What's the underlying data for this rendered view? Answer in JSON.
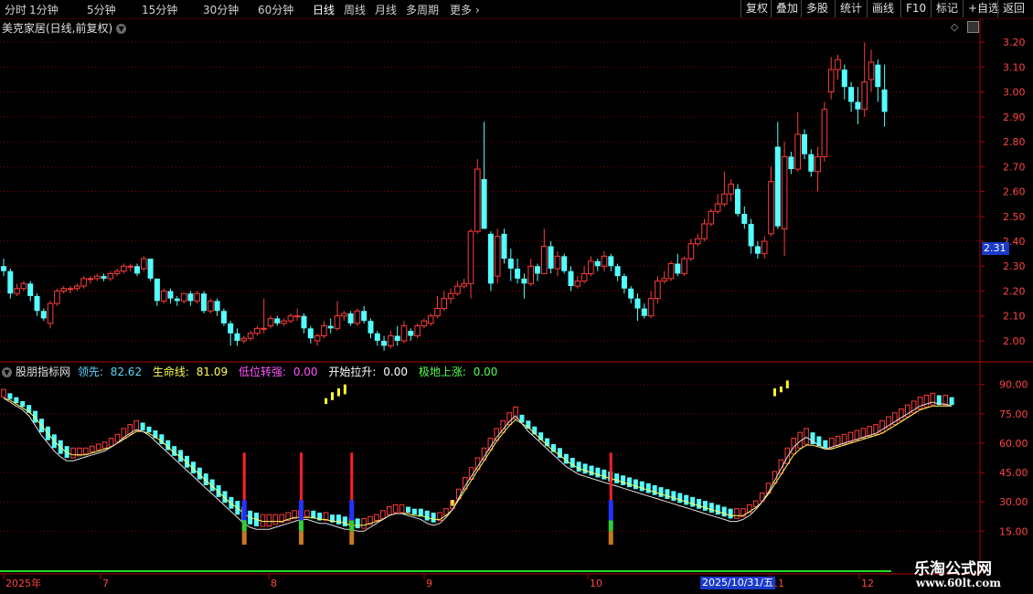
{
  "toolbar": {
    "periods": [
      "分时",
      "1分钟",
      "5分钟",
      "15分钟",
      "30分钟",
      "60分钟",
      "日线",
      "周线",
      "月线",
      "多周期",
      "更多"
    ],
    "active_period": "日线",
    "buttons": [
      "复权",
      "叠加",
      "多股",
      "统计",
      "画线",
      "F10",
      "标记",
      "+自选",
      "返回"
    ]
  },
  "stock": {
    "title": "美克家居(日线,前复权)"
  },
  "price_axis": {
    "ticks": [
      "3.20",
      "3.10",
      "3.00",
      "2.90",
      "2.80",
      "2.70",
      "2.60",
      "2.50",
      "2.40",
      "2.30",
      "2.20",
      "2.10",
      "2.00"
    ],
    "current_price": "2.31"
  },
  "indicator": {
    "name": "股朋指标网",
    "items": [
      {
        "label": "领先:",
        "value": "82.62",
        "color": "#5bd8ff"
      },
      {
        "label": "生命线:",
        "value": "81.09",
        "color": "#ffff55"
      },
      {
        "label": "低位转强:",
        "value": "0.00",
        "color": "#ff55ff"
      },
      {
        "label": "开始拉升:",
        "value": "0.00",
        "color": "#ffffff"
      },
      {
        "label": "极地上涨:",
        "value": "0.00",
        "color": "#55ff55"
      }
    ],
    "ticks": [
      "90.00",
      "75.00",
      "60.00",
      "45.00",
      "30.00",
      "15.00"
    ]
  },
  "time_axis": {
    "labels": [
      "2025年",
      "7",
      "8",
      "9",
      "10",
      "11",
      "12"
    ],
    "cursor_date": "2025/10/31/五"
  },
  "watermark": {
    "line1": "乐淘公式网",
    "line2": "www.60lt.com"
  },
  "colors": {
    "up": "#ff3c3c",
    "down": "#54ffff",
    "grid": "#8b0000",
    "axis": "#b00000"
  },
  "chart_data": {
    "type": "candlestick",
    "note_series": [
      "open",
      "close",
      "low",
      "high"
    ],
    "candles": [
      [
        2.3,
        2.28,
        2.26,
        2.33
      ],
      [
        2.28,
        2.19,
        2.17,
        2.29
      ],
      [
        2.19,
        2.21,
        2.18,
        2.23
      ],
      [
        2.21,
        2.23,
        2.2,
        2.24
      ],
      [
        2.23,
        2.18,
        2.16,
        2.24
      ],
      [
        2.18,
        2.12,
        2.1,
        2.19
      ],
      [
        2.12,
        2.09,
        2.08,
        2.13
      ],
      [
        2.07,
        2.15,
        2.05,
        2.16
      ],
      [
        2.15,
        2.2,
        2.14,
        2.21
      ],
      [
        2.2,
        2.21,
        2.19,
        2.22
      ],
      [
        2.21,
        2.21,
        2.19,
        2.22
      ],
      [
        2.21,
        2.22,
        2.2,
        2.23
      ],
      [
        2.22,
        2.25,
        2.21,
        2.26
      ],
      [
        2.25,
        2.25,
        2.23,
        2.26
      ],
      [
        2.25,
        2.26,
        2.24,
        2.27
      ],
      [
        2.26,
        2.25,
        2.24,
        2.27
      ],
      [
        2.25,
        2.27,
        2.24,
        2.28
      ],
      [
        2.27,
        2.28,
        2.26,
        2.29
      ],
      [
        2.28,
        2.3,
        2.27,
        2.31
      ],
      [
        2.3,
        2.3,
        2.28,
        2.31
      ],
      [
        2.3,
        2.27,
        2.26,
        2.31
      ],
      [
        2.29,
        2.33,
        2.28,
        2.34
      ],
      [
        2.33,
        2.25,
        2.24,
        2.33
      ],
      [
        2.25,
        2.16,
        2.14,
        2.25
      ],
      [
        2.16,
        2.2,
        2.15,
        2.21
      ],
      [
        2.2,
        2.17,
        2.15,
        2.21
      ],
      [
        2.17,
        2.16,
        2.14,
        2.18
      ],
      [
        2.16,
        2.19,
        2.15,
        2.19
      ],
      [
        2.19,
        2.16,
        2.14,
        2.2
      ],
      [
        2.16,
        2.19,
        2.15,
        2.2
      ],
      [
        2.19,
        2.12,
        2.11,
        2.2
      ],
      [
        2.12,
        2.16,
        2.11,
        2.17
      ],
      [
        2.16,
        2.12,
        2.1,
        2.17
      ],
      [
        2.12,
        2.07,
        2.06,
        2.13
      ],
      [
        2.07,
        2.03,
        1.98,
        2.08
      ],
      [
        2.03,
        2.0,
        1.98,
        2.05
      ],
      [
        2.0,
        2.01,
        1.99,
        2.02
      ],
      [
        2.01,
        2.03,
        2.0,
        2.04
      ],
      [
        2.03,
        2.05,
        2.02,
        2.06
      ],
      [
        2.05,
        2.05,
        2.03,
        2.17
      ],
      [
        2.06,
        2.09,
        2.05,
        2.1
      ],
      [
        2.09,
        2.07,
        2.06,
        2.1
      ],
      [
        2.07,
        2.08,
        2.06,
        2.09
      ],
      [
        2.08,
        2.1,
        2.07,
        2.11
      ],
      [
        2.1,
        2.1,
        2.08,
        2.13
      ],
      [
        2.1,
        2.05,
        2.03,
        2.11
      ],
      [
        2.05,
        2.01,
        1.99,
        2.06
      ],
      [
        2.0,
        2.02,
        1.98,
        2.03
      ],
      [
        2.02,
        2.06,
        2.01,
        2.08
      ],
      [
        2.06,
        2.05,
        2.03,
        2.09
      ],
      [
        2.05,
        2.1,
        2.04,
        2.16
      ],
      [
        2.1,
        2.11,
        2.08,
        2.12
      ],
      [
        2.11,
        2.07,
        2.06,
        2.12
      ],
      [
        2.07,
        2.12,
        2.06,
        2.13
      ],
      [
        2.12,
        2.08,
        2.07,
        2.14
      ],
      [
        2.08,
        2.03,
        2.01,
        2.09
      ],
      [
        2.03,
        2.0,
        1.98,
        2.04
      ],
      [
        2.0,
        1.98,
        1.96,
        2.02
      ],
      [
        1.98,
        2.02,
        1.97,
        2.04
      ],
      [
        2.02,
        2.0,
        1.98,
        2.06
      ],
      [
        2.0,
        2.06,
        1.99,
        2.08
      ],
      [
        2.04,
        2.02,
        2.0,
        2.05
      ],
      [
        2.02,
        2.06,
        2.01,
        2.07
      ],
      [
        2.06,
        2.08,
        2.05,
        2.09
      ],
      [
        2.07,
        2.1,
        2.06,
        2.11
      ],
      [
        2.1,
        2.13,
        2.09,
        2.18
      ],
      [
        2.13,
        2.17,
        2.12,
        2.2
      ],
      [
        2.17,
        2.19,
        2.15,
        2.21
      ],
      [
        2.19,
        2.22,
        2.18,
        2.24
      ],
      [
        2.22,
        2.23,
        2.21,
        2.25
      ],
      [
        2.23,
        2.44,
        2.17,
        2.45
      ],
      [
        2.44,
        2.69,
        2.43,
        2.73
      ],
      [
        2.65,
        2.45,
        2.45,
        2.88
      ],
      [
        2.43,
        2.23,
        2.2,
        2.44
      ],
      [
        2.26,
        2.42,
        2.23,
        2.45
      ],
      [
        2.43,
        2.33,
        2.31,
        2.45
      ],
      [
        2.33,
        2.29,
        2.24,
        2.37
      ],
      [
        2.29,
        2.25,
        2.23,
        2.33
      ],
      [
        2.25,
        2.23,
        2.17,
        2.27
      ],
      [
        2.23,
        2.3,
        2.22,
        2.33
      ],
      [
        2.3,
        2.27,
        2.24,
        2.31
      ],
      [
        2.27,
        2.38,
        2.27,
        2.45
      ],
      [
        2.38,
        2.29,
        2.27,
        2.4
      ],
      [
        2.29,
        2.34,
        2.26,
        2.36
      ],
      [
        2.34,
        2.28,
        2.27,
        2.35
      ],
      [
        2.28,
        2.22,
        2.2,
        2.3
      ],
      [
        2.22,
        2.24,
        2.21,
        2.26
      ],
      [
        2.24,
        2.27,
        2.23,
        2.3
      ],
      [
        2.27,
        2.32,
        2.26,
        2.34
      ],
      [
        2.32,
        2.3,
        2.28,
        2.33
      ],
      [
        2.3,
        2.34,
        2.28,
        2.36
      ],
      [
        2.34,
        2.3,
        2.28,
        2.35
      ],
      [
        2.3,
        2.26,
        2.24,
        2.31
      ],
      [
        2.26,
        2.21,
        2.19,
        2.27
      ],
      [
        2.21,
        2.17,
        2.15,
        2.22
      ],
      [
        2.17,
        2.13,
        2.08,
        2.19
      ],
      [
        2.13,
        2.1,
        2.09,
        2.15
      ],
      [
        2.1,
        2.17,
        2.09,
        2.2
      ],
      [
        2.17,
        2.24,
        2.15,
        2.26
      ],
      [
        2.24,
        2.25,
        2.23,
        2.28
      ],
      [
        2.25,
        2.31,
        2.24,
        2.32
      ],
      [
        2.31,
        2.27,
        2.26,
        2.35
      ],
      [
        2.27,
        2.33,
        2.26,
        2.34
      ],
      [
        2.33,
        2.39,
        2.32,
        2.41
      ],
      [
        2.39,
        2.41,
        2.38,
        2.43
      ],
      [
        2.41,
        2.47,
        2.4,
        2.49
      ],
      [
        2.47,
        2.52,
        2.46,
        2.53
      ],
      [
        2.52,
        2.55,
        2.51,
        2.59
      ],
      [
        2.55,
        2.59,
        2.54,
        2.68
      ],
      [
        2.59,
        2.63,
        2.56,
        2.65
      ],
      [
        2.61,
        2.51,
        2.5,
        2.63
      ],
      [
        2.51,
        2.47,
        2.45,
        2.54
      ],
      [
        2.47,
        2.38,
        2.35,
        2.49
      ],
      [
        2.38,
        2.35,
        2.33,
        2.4
      ],
      [
        2.35,
        2.4,
        2.33,
        2.42
      ],
      [
        2.43,
        2.64,
        2.42,
        2.7
      ],
      [
        2.78,
        2.46,
        2.45,
        2.88
      ],
      [
        2.45,
        2.74,
        2.34,
        2.8
      ],
      [
        2.74,
        2.69,
        2.67,
        2.76
      ],
      [
        2.69,
        2.83,
        2.68,
        2.92
      ],
      [
        2.83,
        2.75,
        2.73,
        2.85
      ],
      [
        2.75,
        2.68,
        2.66,
        2.77
      ],
      [
        2.68,
        2.74,
        2.6,
        2.78
      ],
      [
        2.74,
        2.93,
        2.72,
        2.96
      ],
      [
        3.0,
        3.09,
        2.97,
        3.14
      ],
      [
        3.09,
        3.13,
        3.05,
        3.15
      ],
      [
        3.09,
        3.02,
        2.97,
        3.11
      ],
      [
        3.02,
        2.96,
        2.92,
        3.04
      ],
      [
        2.96,
        2.93,
        2.87,
        3.02
      ],
      [
        2.93,
        3.04,
        2.9,
        3.2
      ],
      [
        3.05,
        3.12,
        3.0,
        3.17
      ],
      [
        3.11,
        3.02,
        2.96,
        3.13
      ],
      [
        3.01,
        2.92,
        2.86,
        3.11
      ]
    ]
  },
  "indicator_data": {
    "lead": [
      86,
      84,
      82,
      80,
      77,
      72,
      67,
      63,
      59,
      56,
      54,
      54,
      55,
      56,
      57,
      58,
      59,
      61,
      63,
      66,
      68,
      70,
      69,
      67,
      64,
      61,
      58,
      55,
      52,
      49,
      46,
      43,
      40,
      37,
      34,
      31,
      28,
      25,
      22,
      20,
      19,
      19,
      19,
      20,
      21,
      22,
      23,
      24,
      24,
      23,
      22,
      22,
      21,
      20,
      19,
      19,
      18,
      18,
      20,
      22,
      24,
      26,
      27,
      27,
      26,
      25,
      24,
      22,
      21,
      22,
      25,
      29,
      35,
      41,
      46,
      51,
      56,
      61,
      66,
      70,
      74,
      77,
      73,
      69,
      66,
      63,
      60,
      57,
      54,
      51,
      49,
      47,
      46,
      45,
      44,
      43,
      42,
      41,
      40,
      39,
      38,
      37,
      36,
      35,
      34,
      33,
      32,
      31,
      30,
      29,
      28,
      27,
      26,
      25,
      24,
      23,
      23,
      24,
      26,
      29,
      33,
      38,
      44,
      50,
      56,
      61,
      64,
      66,
      64,
      62,
      60,
      61,
      62,
      63,
      64,
      65,
      66,
      67,
      68,
      70,
      72,
      74,
      76,
      78,
      80,
      82,
      83,
      84,
      83,
      83,
      82
    ],
    "life": [
      85,
      84,
      82,
      80,
      78,
      75,
      71,
      67,
      63,
      60,
      57,
      56,
      56,
      56,
      57,
      58,
      59,
      60,
      62,
      64,
      66,
      68,
      68,
      67,
      65,
      63,
      60,
      57,
      55,
      52,
      49,
      46,
      43,
      40,
      37,
      34,
      31,
      29,
      26,
      24,
      23,
      22,
      22,
      22,
      22,
      23,
      24,
      24,
      24,
      24,
      23,
      23,
      22,
      22,
      21,
      20,
      20,
      20,
      21,
      22,
      23,
      25,
      26,
      26,
      26,
      25,
      25,
      24,
      23,
      23,
      25,
      28,
      33,
      38,
      43,
      48,
      53,
      58,
      63,
      67,
      71,
      74,
      72,
      70,
      67,
      64,
      61,
      58,
      56,
      53,
      51,
      49,
      48,
      47,
      46,
      45,
      44,
      43,
      42,
      41,
      40,
      39,
      38,
      37,
      36,
      35,
      34,
      33,
      32,
      31,
      30,
      29,
      28,
      27,
      26,
      25,
      25,
      25,
      27,
      29,
      32,
      36,
      41,
      46,
      51,
      56,
      59,
      61,
      61,
      60,
      59,
      59,
      60,
      61,
      62,
      63,
      64,
      65,
      66,
      67,
      69,
      71,
      73,
      75,
      77,
      79,
      80,
      81,
      81,
      81,
      81
    ],
    "yellow_spikes": [
      [
        51,
        80,
        83
      ],
      [
        52,
        82,
        86
      ],
      [
        53,
        84,
        88
      ],
      [
        54,
        85,
        90
      ],
      [
        71,
        28,
        31
      ],
      [
        122,
        84,
        88
      ],
      [
        123,
        86,
        89
      ],
      [
        124,
        88,
        92
      ]
    ],
    "signal_bars": [
      38,
      47,
      55,
      96
    ]
  }
}
